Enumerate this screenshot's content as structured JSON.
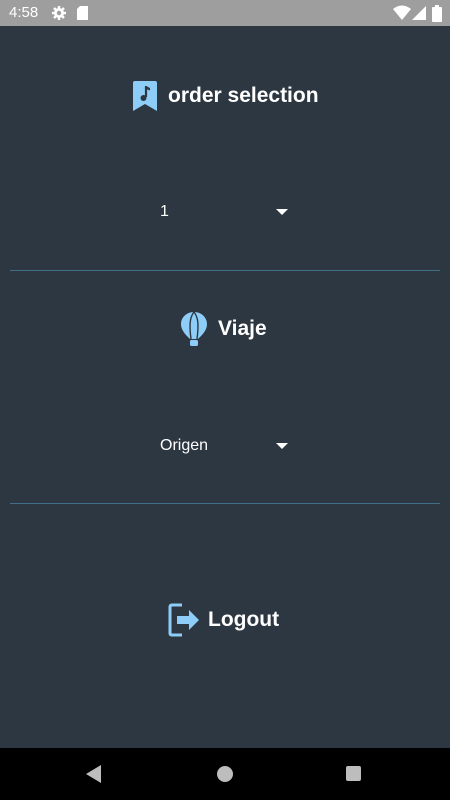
{
  "status_bar": {
    "time": "4:58",
    "icons": [
      "gear-icon",
      "sd-card-icon",
      "wifi-icon",
      "signal-icon",
      "battery-icon"
    ]
  },
  "order_section": {
    "title": "order selection",
    "icon": "music-bookmark-icon",
    "selected_value": "1"
  },
  "viaje_section": {
    "title": "Viaje",
    "icon": "hot-air-balloon-icon",
    "selected_value": "Origen"
  },
  "logout": {
    "label": "Logout",
    "icon": "logout-icon"
  },
  "colors": {
    "background": "#2d3741",
    "accent_icon": "#8ecdf7",
    "divider": "#3f6f86",
    "status_bar": "#9e9e9e",
    "nav_bar": "#000000"
  },
  "nav_bar": {
    "icons": [
      "back-icon",
      "home-icon",
      "recents-icon"
    ]
  }
}
